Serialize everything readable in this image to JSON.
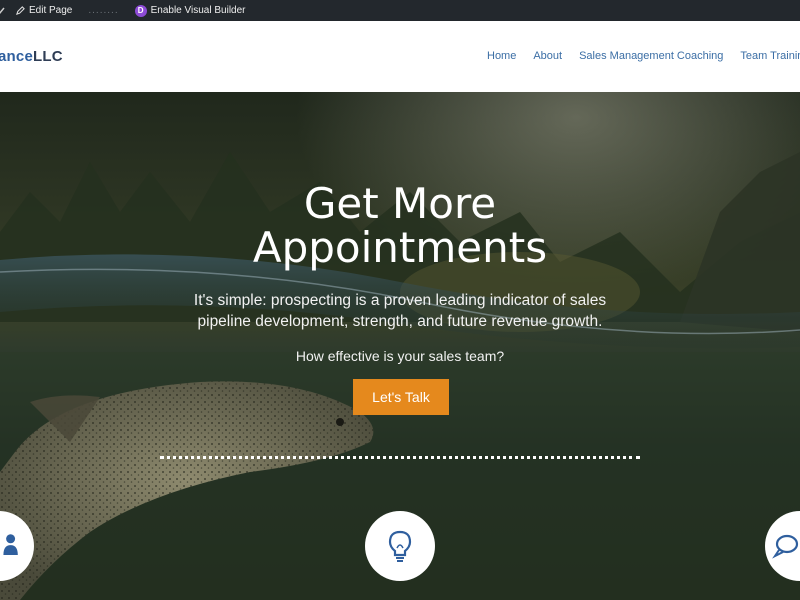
{
  "adminbar": {
    "edit_page": "Edit Page",
    "blurred": "........",
    "divi_letter": "D",
    "visual_builder": "Enable Visual Builder"
  },
  "header": {
    "logo_part1": "ance",
    "logo_part2": "LLC",
    "nav": [
      "Home",
      "About",
      "Sales Management Coaching",
      "Team Training"
    ]
  },
  "hero": {
    "title_line1": "Get More",
    "title_line2": "Appointments",
    "subtitle": "It's simple: prospecting is a proven leading indicator of sales pipeline development, strength, and future revenue growth.",
    "question": "How effective is your sales team?",
    "cta": "Let's Talk"
  },
  "icons": [
    "people-icon",
    "lightbulb-icon",
    "chat-icon"
  ],
  "colors": {
    "admin_bar": "#23282d",
    "nav_link": "#3b6ea5",
    "cta_button": "#e5891d",
    "icon_blue": "#2f5f9e"
  }
}
